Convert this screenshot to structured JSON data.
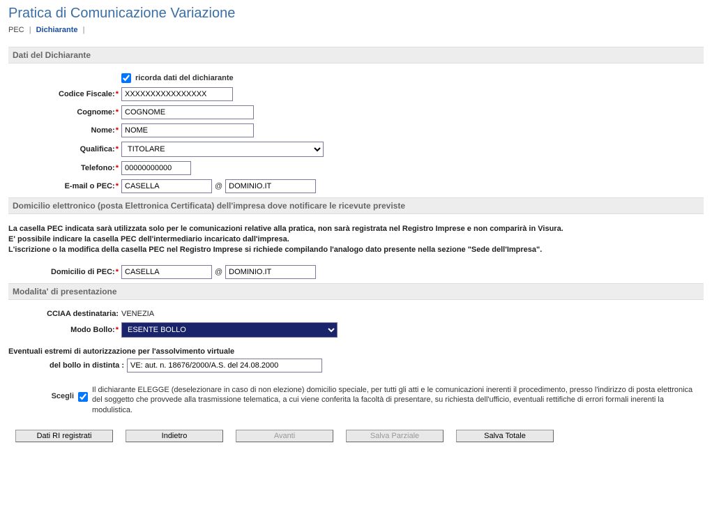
{
  "page_title": "Pratica di Comunicazione Variazione",
  "breadcrumb": {
    "pec": "PEC",
    "dichiarante": "Dichiarante"
  },
  "section1_title": "Dati del Dichiarante",
  "remember_label": "ricorda dati del dichiarante",
  "remember_checked": true,
  "labels": {
    "codice_fiscale": "Codice Fiscale:",
    "cognome": "Cognome:",
    "nome": "Nome:",
    "qualifica": "Qualifica:",
    "telefono": "Telefono:",
    "email_pec": "E-mail o PEC:"
  },
  "values": {
    "codice_fiscale": "XXXXXXXXXXXXXXXX",
    "cognome": "COGNOME",
    "nome": "NOME",
    "qualifica": "TITOLARE",
    "telefono": "00000000000",
    "email_local": "CASELLA",
    "email_domain": "DOMINIO.IT"
  },
  "section2_title": "Domicilio elettronico (posta Elettronica Certificata) dell'impresa dove notificare le ricevute previste",
  "section2_info_line1": "La casella PEC indicata sarà utilizzata solo per le comunicazioni relative alla pratica, non sarà registrata nel Registro Imprese e non comparirà in Visura.",
  "section2_info_line2": "E' possibile indicare la casella PEC dell'intermediario incaricato dall'impresa.",
  "section2_info_line3": "L'iscrizione o la modifica della casella PEC nel Registro Imprese si richiede compilando l'analogo dato presente nella sezione \"Sede dell'Impresa\".",
  "domicilio_pec_label": "Domicilio di PEC:",
  "domicilio_pec_local": "CASELLA",
  "domicilio_pec_domain": "DOMINIO.IT",
  "section3_title": "Modalita' di presentazione",
  "cciaa_label": "CCIAA destinataria:",
  "cciaa_value": "VENEZIA",
  "modo_bollo_label": "Modo Bollo:",
  "modo_bollo_value": "ESENTE BOLLO",
  "estremi_header": "Eventuali estremi di autorizzazione per l'assolvimento virtuale",
  "distinta_label": "del bollo in distinta :",
  "distinta_value": "VE: aut. n. 18676/2000/A.S. del 24.08.2000",
  "scegli_label": "Scegli",
  "scegli_checked": true,
  "scegli_text": "Il dichiarante ELEGGE (deselezionare in caso di non elezione) domicilio speciale, per tutti gli atti e le comunicazioni inerenti il procedimento, presso l'indirizzo di posta elettronica del soggetto che provvede alla trasmissione telematica, a cui viene conferita la facoltà di presentare, su richiesta dell'ufficio, eventuali rettifiche di errori formali inerenti la modulistica.",
  "buttons": {
    "dati_ri": "Dati RI registrati",
    "indietro": "Indietro",
    "avanti": "Avanti",
    "salva_parziale": "Salva Parziale",
    "salva_totale": "Salva Totale"
  },
  "at_symbol": "@"
}
